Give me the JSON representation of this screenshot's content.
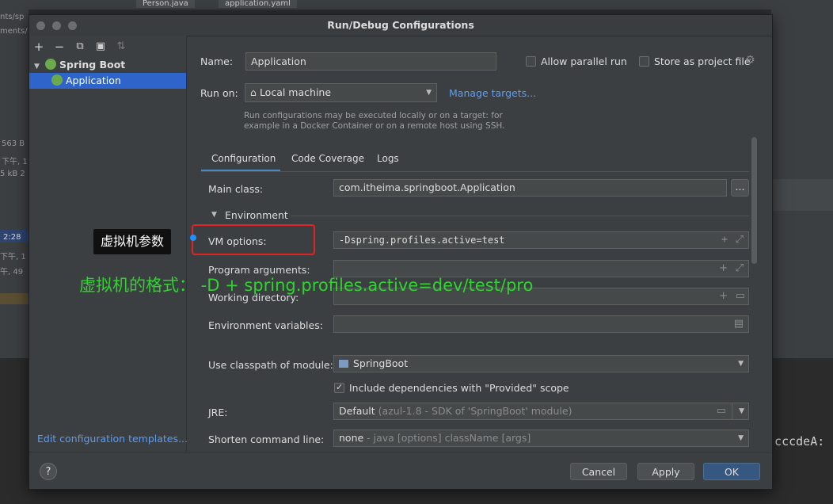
{
  "background": {
    "tabs": [
      "Person.java",
      "application.yaml"
    ],
    "left_texts": [
      "nts/sp",
      "ments/",
      "563 B",
      "下午, 1",
      "5 kB 2",
      "2:28",
      "下午, 1",
      "午, 49"
    ],
    "code_text": "n cccdeA:"
  },
  "dialog": {
    "title": "Run/Debug Configurations",
    "toolbar": [
      "+",
      "−",
      "⧉",
      "▣",
      "⇅"
    ],
    "tree": {
      "group": "Spring Boot",
      "item": "Application"
    },
    "edit_templates": "Edit configuration templates...",
    "name_label": "Name:",
    "name_value": "Application",
    "allow_parallel": "Allow parallel run",
    "store_as_project": "Store as project file",
    "run_on_label": "Run on:",
    "run_on_value": "Local machine",
    "manage_targets": "Manage targets...",
    "run_hint_1": "Run configurations may be executed locally or on a target: for",
    "run_hint_2": "example in a Docker Container or on a remote host using SSH.",
    "tabs": [
      "Configuration",
      "Code Coverage",
      "Logs"
    ],
    "main_class_label": "Main class:",
    "main_class_value": "com.itheima.springboot.Application",
    "browse": "...",
    "environment_label": "Environment",
    "vm_options_label": "VM options:",
    "vm_options_value": "-Dspring.profiles.active=test",
    "program_args_label": "Program arguments:",
    "working_dir_label": "Working directory:",
    "env_vars_label": "Environment variables:",
    "classpath_label": "Use classpath of module:",
    "classpath_value": "SpringBoot",
    "include_deps": "Include dependencies with \"Provided\" scope",
    "jre_label": "JRE:",
    "jre_default": "Default",
    "jre_detail": "(azul-1.8 - SDK of 'SpringBoot' module)",
    "shorten_label": "Shorten command line:",
    "shorten_value": "none",
    "shorten_detail": "- java [options] className [args]",
    "help": "?",
    "cancel": "Cancel",
    "apply": "Apply",
    "ok": "OK"
  },
  "annotations": {
    "callout": "虚拟机参数",
    "format_note": "虚拟机的格式： -D + spring.profiles.active=dev/test/pro"
  },
  "colors": {
    "accent": "#2f65ca",
    "link": "#589df6",
    "annotation_red": "#e02424",
    "annotation_green": "#2fd42f",
    "primary_button": "#365880"
  }
}
